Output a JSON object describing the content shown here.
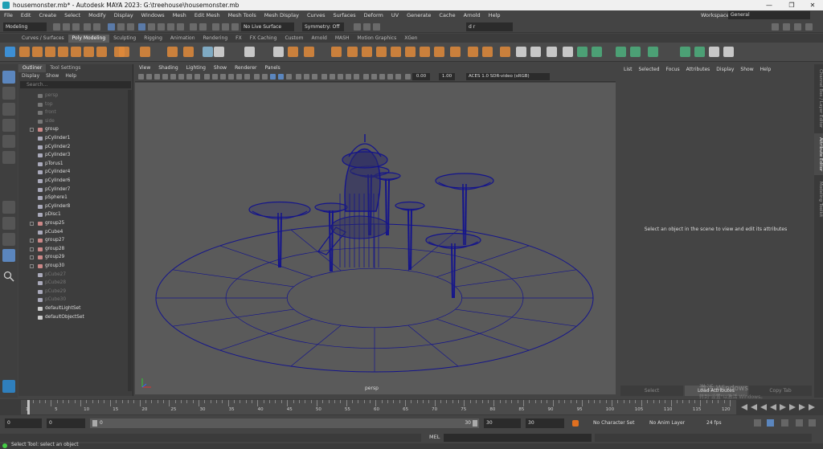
{
  "window": {
    "title": "housemonster.mb* - Autodesk MAYA 2023: G:\\treehouse\\housemonster.mb"
  },
  "menubar": {
    "items": [
      "File",
      "Edit",
      "Create",
      "Select",
      "Modify",
      "Display",
      "Windows",
      "Mesh",
      "Edit Mesh",
      "Mesh Tools",
      "Mesh Display",
      "Curves",
      "Surfaces",
      "Deform",
      "UV",
      "Generate",
      "Cache",
      "Arnold",
      "Help"
    ],
    "workspace_label": "Workspace :",
    "workspace_value": "General"
  },
  "statusline": {
    "mode": "Modeling",
    "live_surface": "No Live Surface",
    "symmetry": "Symmetry: Off",
    "user": "d r"
  },
  "shelf": {
    "tabs": [
      "Curves / Surfaces",
      "Poly Modeling",
      "Sculpting",
      "Rigging",
      "Animation",
      "Rendering",
      "FX",
      "FX Caching",
      "Custom",
      "Arnold",
      "MASH",
      "Motion Graphics",
      "XGen"
    ],
    "active_tab": "Poly Modeling"
  },
  "outliner": {
    "tabs": [
      "Outliner",
      "Tool Settings"
    ],
    "menu": [
      "Display",
      "Show",
      "Help"
    ],
    "search_placeholder": "Search...",
    "items": [
      {
        "label": "persp",
        "kind": "camera",
        "dim": true,
        "expand": false
      },
      {
        "label": "top",
        "kind": "camera",
        "dim": true,
        "expand": false
      },
      {
        "label": "front",
        "kind": "camera",
        "dim": true,
        "expand": false
      },
      {
        "label": "side",
        "kind": "camera",
        "dim": true,
        "expand": false
      },
      {
        "label": "group",
        "kind": "group",
        "dim": false,
        "expand": true
      },
      {
        "label": "pCylinder1",
        "kind": "mesh",
        "dim": false,
        "expand": false
      },
      {
        "label": "pCylinder2",
        "kind": "mesh",
        "dim": false,
        "expand": false
      },
      {
        "label": "pCylinder3",
        "kind": "mesh",
        "dim": false,
        "expand": false
      },
      {
        "label": "pTorus1",
        "kind": "mesh",
        "dim": false,
        "expand": false
      },
      {
        "label": "pCylinder4",
        "kind": "mesh",
        "dim": false,
        "expand": false
      },
      {
        "label": "pCylinder6",
        "kind": "mesh",
        "dim": false,
        "expand": false
      },
      {
        "label": "pCylinder7",
        "kind": "mesh",
        "dim": false,
        "expand": false
      },
      {
        "label": "pSphere1",
        "kind": "mesh",
        "dim": false,
        "expand": false
      },
      {
        "label": "pCylinder8",
        "kind": "mesh",
        "dim": false,
        "expand": false
      },
      {
        "label": "pDisc1",
        "kind": "mesh",
        "dim": false,
        "expand": false
      },
      {
        "label": "group25",
        "kind": "group",
        "dim": false,
        "expand": true
      },
      {
        "label": "pCube4",
        "kind": "mesh",
        "dim": false,
        "expand": false
      },
      {
        "label": "group27",
        "kind": "group",
        "dim": false,
        "expand": true
      },
      {
        "label": "group28",
        "kind": "group",
        "dim": false,
        "expand": true
      },
      {
        "label": "group29",
        "kind": "group",
        "dim": false,
        "expand": true
      },
      {
        "label": "group30",
        "kind": "group",
        "dim": false,
        "expand": true
      },
      {
        "label": "pCube27",
        "kind": "mesh",
        "dim": true,
        "expand": false
      },
      {
        "label": "pCube28",
        "kind": "mesh",
        "dim": true,
        "expand": false
      },
      {
        "label": "pCube29",
        "kind": "mesh",
        "dim": true,
        "expand": false
      },
      {
        "label": "pCube30",
        "kind": "mesh",
        "dim": true,
        "expand": false
      },
      {
        "label": "defaultLightSet",
        "kind": "set",
        "dim": false,
        "expand": false
      },
      {
        "label": "defaultObjectSet",
        "kind": "set",
        "dim": false,
        "expand": false
      }
    ]
  },
  "viewport": {
    "menu": [
      "View",
      "Shading",
      "Lighting",
      "Show",
      "Renderer",
      "Panels"
    ],
    "exposure": "0.00",
    "gamma": "1.00",
    "color_space": "ACES 1.0 SDR-video (sRGB)",
    "camera_label": "persp",
    "wire_color": "#14148c"
  },
  "attribute_editor": {
    "menu": [
      "List",
      "Selected",
      "Focus",
      "Attributes",
      "Display",
      "Show",
      "Help"
    ],
    "message": "Select an object in the scene to view and edit its attributes",
    "buttons": [
      "Select",
      "Load Attributes",
      "Copy Tab"
    ]
  },
  "side_tabs": [
    "Channel Box / Layer Editor",
    "Attribute Editor",
    "Modeling Toolkit"
  ],
  "timeslider": {
    "ticks": [
      "1",
      "5",
      "10",
      "15",
      "20",
      "25",
      "30",
      "35",
      "40",
      "45",
      "50",
      "55",
      "60",
      "65",
      "70",
      "75",
      "80",
      "85",
      "90",
      "95",
      "100",
      "105",
      "110",
      "115",
      "120"
    ]
  },
  "range": {
    "start": "0",
    "anim_start": "0",
    "range_start": "0",
    "range_end": "30",
    "anim_end": "30",
    "end": "30",
    "character_set": "No Character Set",
    "anim_layer": "No Anim Layer",
    "fps": "24 fps"
  },
  "commandline": {
    "lang": "MEL"
  },
  "helpline": {
    "text": "Select Tool: select an object"
  },
  "watermark": {
    "line1": "激活 Windows",
    "line2": "转到\"设置\"以激活 Windows。"
  }
}
